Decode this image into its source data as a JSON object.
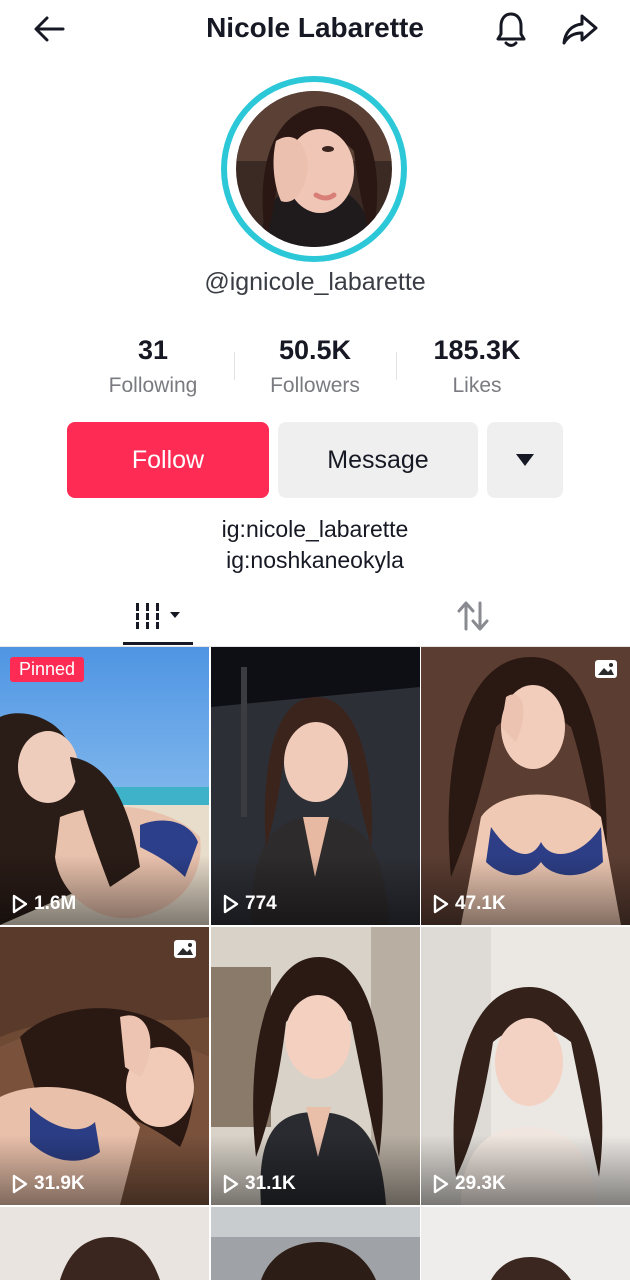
{
  "header": {
    "title": "Nicole Labarette",
    "icons": [
      "back-arrow-icon",
      "bell-icon",
      "share-icon"
    ]
  },
  "profile": {
    "username": "@ignicole_labarette",
    "stats": [
      {
        "value": "31",
        "label": "Following"
      },
      {
        "value": "50.5K",
        "label": "Followers"
      },
      {
        "value": "185.3K",
        "label": "Likes"
      }
    ],
    "accent_ring_color": "#2cc8d8"
  },
  "actions": {
    "follow_label": "Follow",
    "message_label": "Message",
    "follow_color": "#fe2c55"
  },
  "bio": {
    "line1": "ig:nicole_labarette",
    "line2": "ig:noshkaneokyla"
  },
  "tabs": [
    "videos-grid-icon",
    "reposts-icon"
  ],
  "videos": [
    {
      "views": "1.6M",
      "pinned_label": "Pinned",
      "photo": false
    },
    {
      "views": "774",
      "photo": false
    },
    {
      "views": "47.1K",
      "photo": true
    },
    {
      "views": "31.9K",
      "photo": true
    },
    {
      "views": "31.1K",
      "photo": false
    },
    {
      "views": "29.3K",
      "photo": false
    }
  ]
}
